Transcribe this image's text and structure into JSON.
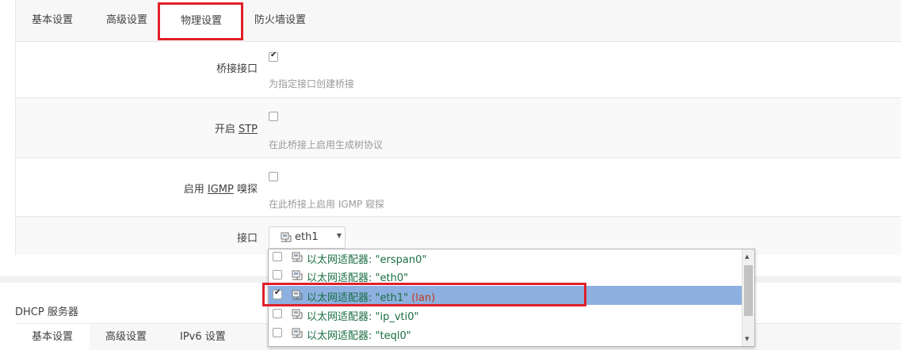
{
  "top_tabs": [
    "基本设置",
    "高级设置",
    "物理设置",
    "防火墙设置"
  ],
  "active_tab_index": 2,
  "highlight_color": "#e0202a",
  "fields": {
    "bridge": {
      "label": "桥接接口",
      "checked": true,
      "description": "为指定接口创建桥接"
    },
    "stp": {
      "label_prefix": "开启 ",
      "label_abbr": "STP",
      "checked": false,
      "description": "在此桥接上启用生成树协议"
    },
    "igmp": {
      "label_prefix": "启用 ",
      "label_abbr": "IGMP",
      "label_suffix": " 嗅探",
      "checked": false,
      "description": "在此桥接上启用 IGMP 窥探"
    },
    "interface": {
      "label": "接口",
      "selected_value": "eth1"
    }
  },
  "dropdown": {
    "items": [
      {
        "text": "以太网适配器: \"erspan0\"",
        "tag": "",
        "checked": false
      },
      {
        "text": "以太网适配器: \"eth0\"",
        "tag": "",
        "checked": false
      },
      {
        "text": "以太网适配器: \"eth1\"",
        "tag": "(lan)",
        "checked": true
      },
      {
        "text": "以太网适配器: \"ip_vti0\"",
        "tag": "",
        "checked": false
      },
      {
        "text": "以太网适配器: \"teql0\"",
        "tag": "",
        "checked": false
      }
    ]
  },
  "dhcp_section": {
    "title": "DHCP 服务器",
    "tabs": [
      "基本设置",
      "高级设置",
      "IPv6 设置"
    ]
  }
}
